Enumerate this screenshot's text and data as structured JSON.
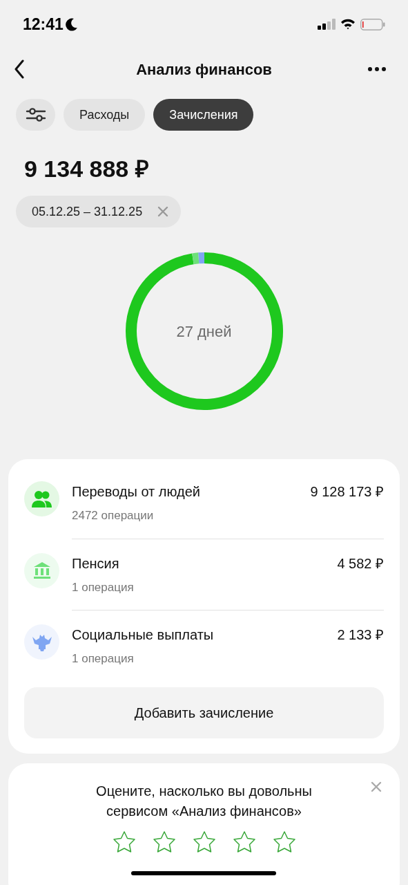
{
  "status_bar": {
    "time": "12:41"
  },
  "header": {
    "title": "Анализ финансов"
  },
  "tabs": [
    {
      "label": "Расходы",
      "selected": false
    },
    {
      "label": "Зачисления",
      "selected": true
    }
  ],
  "total": "9 134 888 ₽",
  "period": {
    "label": "05.12.25 – 31.12.25"
  },
  "donut": {
    "center_label": "27 дней"
  },
  "categories": [
    {
      "kind": "people",
      "title": "Переводы от людей",
      "subtitle": "2472 операции",
      "amount": "9 128 173 ₽",
      "color": "#1ec81e"
    },
    {
      "kind": "bank",
      "title": "Пенсия",
      "subtitle": "1 операция",
      "amount": "4 582 ₽",
      "color": "#6ee07a"
    },
    {
      "kind": "eagle",
      "title": "Социальные выплаты",
      "subtitle": "1 операция",
      "amount": "2 133 ₽",
      "color": "#80a6f2"
    }
  ],
  "add_button": "Добавить зачисление",
  "rating": {
    "question": "Оцените, насколько вы довольны сервисом «Анализ финансов»",
    "stars": 0
  }
}
